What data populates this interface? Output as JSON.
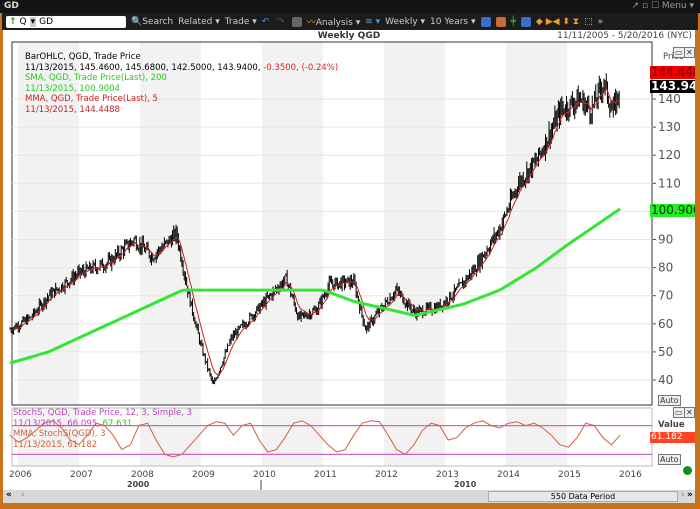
{
  "window": {
    "title": "GD",
    "menu": "Menu"
  },
  "toolbar": {
    "direction_icon": "up-arrow-icon",
    "symbol_type": "Q",
    "symbol": "GD",
    "search": "Search",
    "related": "Related",
    "trade": "Trade",
    "analysis": "Analysis",
    "interval": "Weekly",
    "period": "10 Years"
  },
  "chart": {
    "title": "Weekly QGD",
    "date_range": "11/11/2005 - 5/20/2016 (NYC)",
    "price_label": "Price",
    "value_label": "Value",
    "auto": "Auto",
    "period_label": "550 Data Period"
  },
  "legend": {
    "bar_line1": "BarOHLC, QGD, Trade Price",
    "bar_line2": "11/13/2015, 145.4600, 145.6800, 142.5000, 143.9400,",
    "bar_change": "-0.3500, (-0.24%)",
    "sma_line1": "SMA, QGD, Trade Price(Last),  200",
    "sma_line2": "11/13/2015, 100.9004",
    "mma_line1": "MMA, QGD, Trade Price(Last),  5",
    "mma_line2": "11/13/2015, 144.4488",
    "stoch_line1": "StochS, QGD, Trade Price,  12, 3, Simple, 3",
    "stoch_line2": "11/13/2015, 66.095,",
    "stoch_val2": "67.631",
    "smma_line1": "MMA, StochS(QGD),  3",
    "smma_line2": "11/13/2015, 61.182"
  },
  "tags": {
    "mma": "144.448",
    "close": "143.940",
    "sma": "100.900",
    "stoch": "61.182"
  },
  "colors": {
    "sma": "#33e633",
    "mma": "#cc2222",
    "bars": "#000000",
    "stoch": "#d2603a",
    "stoch_bands": "#cc66cc",
    "accent": "#c8741c"
  },
  "chart_data": {
    "type": "ohlc",
    "x_ticks": [
      "2006",
      "2007",
      "2008",
      "2009",
      "2010",
      "2011",
      "2012",
      "2013",
      "2014",
      "2015",
      "2016"
    ],
    "x_decades": [
      "2000",
      "2010"
    ],
    "y_ticks": [
      40,
      50,
      60,
      70,
      80,
      90,
      100,
      110,
      120,
      130,
      140
    ],
    "ylim": [
      34,
      150
    ],
    "price_keypoints": [
      [
        2005.87,
        58
      ],
      [
        2006.2,
        62
      ],
      [
        2006.5,
        70
      ],
      [
        2007.0,
        78
      ],
      [
        2007.5,
        82
      ],
      [
        2007.9,
        90
      ],
      [
        2008.2,
        84
      ],
      [
        2008.6,
        92
      ],
      [
        2008.8,
        70
      ],
      [
        2009.0,
        52
      ],
      [
        2009.2,
        38
      ],
      [
        2009.5,
        55
      ],
      [
        2009.8,
        62
      ],
      [
        2010.3,
        74
      ],
      [
        2010.4,
        76
      ],
      [
        2010.6,
        62
      ],
      [
        2010.9,
        65
      ],
      [
        2011.1,
        74
      ],
      [
        2011.5,
        75
      ],
      [
        2011.7,
        58
      ],
      [
        2011.9,
        64
      ],
      [
        2012.2,
        72
      ],
      [
        2012.5,
        64
      ],
      [
        2012.9,
        66
      ],
      [
        2013.2,
        72
      ],
      [
        2013.5,
        80
      ],
      [
        2013.9,
        94
      ],
      [
        2014.2,
        110
      ],
      [
        2014.5,
        118
      ],
      [
        2014.9,
        136
      ],
      [
        2015.2,
        140
      ],
      [
        2015.4,
        136
      ],
      [
        2015.6,
        146
      ],
      [
        2015.75,
        135
      ],
      [
        2015.87,
        144
      ]
    ],
    "sma200": [
      [
        2005.87,
        46
      ],
      [
        2006.5,
        50
      ],
      [
        2007.5,
        60
      ],
      [
        2008.7,
        72
      ],
      [
        2010.3,
        72
      ],
      [
        2011.0,
        72
      ],
      [
        2011.5,
        68
      ],
      [
        2012.5,
        63
      ],
      [
        2013.3,
        67
      ],
      [
        2013.9,
        72
      ],
      [
        2014.5,
        80
      ],
      [
        2015.0,
        88
      ],
      [
        2015.87,
        100.9
      ]
    ],
    "stoch": {
      "bands": [
        80,
        20
      ],
      "ylim": [
        0,
        100
      ],
      "values": [
        60,
        45,
        55,
        70,
        85,
        90,
        75,
        50,
        40,
        60,
        85,
        80,
        60,
        30,
        40,
        80,
        85,
        50,
        20,
        15,
        20,
        40,
        60,
        80,
        88,
        85,
        60,
        80,
        85,
        50,
        25,
        30,
        55,
        85,
        90,
        80,
        60,
        40,
        25,
        30,
        60,
        85,
        90,
        88,
        60,
        30,
        20,
        40,
        70,
        85,
        80,
        50,
        55,
        75,
        85,
        90,
        80,
        75,
        85,
        88,
        80,
        85,
        75,
        60,
        40,
        35,
        55,
        85,
        80,
        55,
        40,
        60
      ]
    }
  }
}
